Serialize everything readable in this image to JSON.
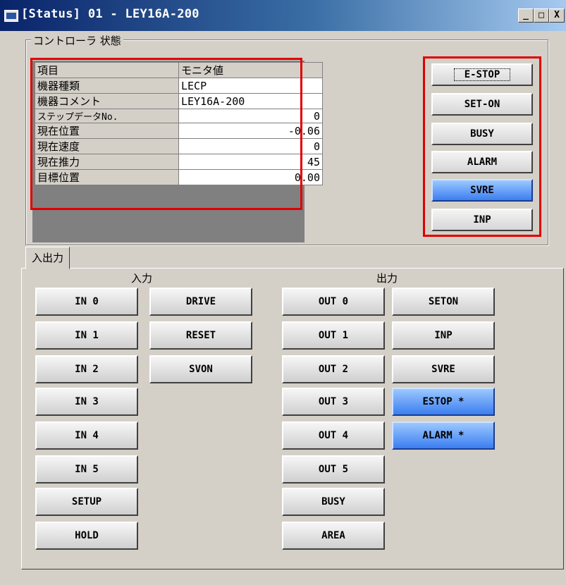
{
  "window": {
    "title": "[Status] 01 - LEY16A-200",
    "controls": [
      "_",
      "□",
      "X"
    ]
  },
  "controller_status": {
    "group_label": "コントローラ 状態",
    "table": {
      "header": [
        "項目",
        "モニタ値"
      ],
      "rows": [
        {
          "label": "機器種類",
          "value": "LECP"
        },
        {
          "label": "機器コメント",
          "value": "LEY16A-200"
        },
        {
          "label": "ステップデータNo.",
          "value": "0"
        },
        {
          "label": "現在位置",
          "value": "-0.06"
        },
        {
          "label": "現在速度",
          "value": "0"
        },
        {
          "label": "現在推力",
          "value": "45"
        },
        {
          "label": "目標位置",
          "value": "0.00"
        }
      ]
    },
    "status_buttons": [
      {
        "label": "E-STOP",
        "active": false
      },
      {
        "label": "SET-ON",
        "active": false
      },
      {
        "label": "BUSY",
        "active": false
      },
      {
        "label": "ALARM",
        "active": false
      },
      {
        "label": "SVRE",
        "active": true
      },
      {
        "label": "INP",
        "active": false
      }
    ]
  },
  "io": {
    "tab_label": "入出力",
    "input_label": "入力",
    "output_label": "出力",
    "inputs_col1": [
      {
        "label": "IN 0",
        "active": false
      },
      {
        "label": "IN 1",
        "active": false
      },
      {
        "label": "IN 2",
        "active": false
      },
      {
        "label": "IN 3",
        "active": false
      },
      {
        "label": "IN 4",
        "active": false
      },
      {
        "label": "IN 5",
        "active": false
      },
      {
        "label": "SETUP",
        "active": false
      },
      {
        "label": "HOLD",
        "active": false
      }
    ],
    "inputs_col2": [
      {
        "label": "DRIVE",
        "active": false
      },
      {
        "label": "RESET",
        "active": false
      },
      {
        "label": "SVON",
        "active": false
      }
    ],
    "outputs_col1": [
      {
        "label": "OUT 0",
        "active": false
      },
      {
        "label": "OUT 1",
        "active": false
      },
      {
        "label": "OUT 2",
        "active": false
      },
      {
        "label": "OUT 3",
        "active": false
      },
      {
        "label": "OUT 4",
        "active": false
      },
      {
        "label": "OUT 5",
        "active": false
      },
      {
        "label": "BUSY",
        "active": false
      },
      {
        "label": "AREA",
        "active": false
      }
    ],
    "outputs_col2": [
      {
        "label": "SETON",
        "active": false
      },
      {
        "label": "INP",
        "active": false
      },
      {
        "label": "SVRE",
        "active": false
      },
      {
        "label": "ESTOP *",
        "active": true
      },
      {
        "label": "ALARM *",
        "active": true
      }
    ]
  },
  "colors": {
    "highlight_border": "#e00000",
    "active_button": "#3b7ef0",
    "window_bg": "#d4d0c8"
  }
}
